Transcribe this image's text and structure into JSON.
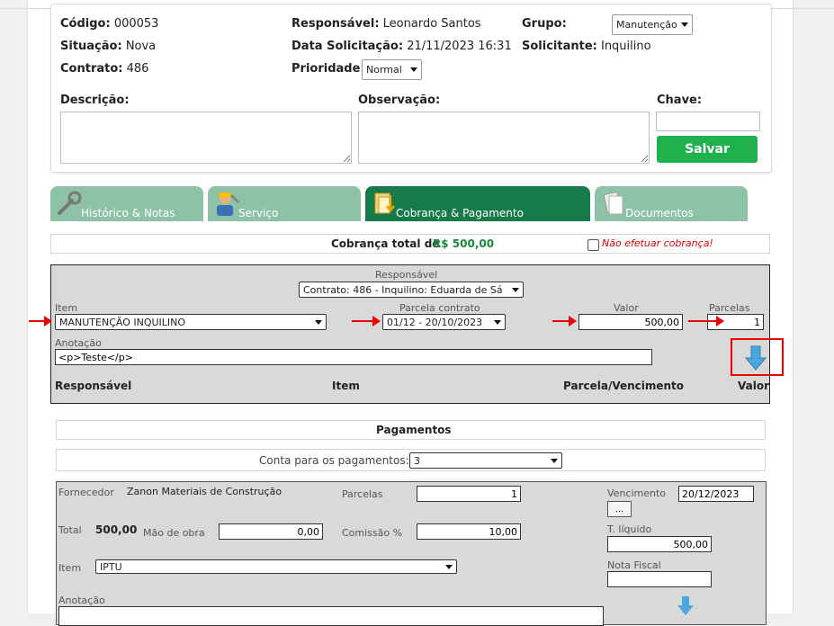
{
  "header": {
    "codigo_label": "Código:",
    "codigo": "000053",
    "situacao_label": "Situação:",
    "situacao": "Nova",
    "contrato_label": "Contrato:",
    "contrato": "486",
    "responsavel_label": "Responsável:",
    "responsavel": "Leonardo Santos",
    "data_label": "Data Solicitação:",
    "data": "21/11/2023 16:31",
    "prioridade_label": "Prioridade:",
    "prioridade": "Normal",
    "grupo_label": "Grupo:",
    "grupo": "Manutenção",
    "solicitante_label": "Solicitante:",
    "solicitante": "Inquilino",
    "descricao_label": "Descrição:",
    "observacao_label": "Observação:",
    "chave_label": "Chave:",
    "chave_value": "",
    "salvar_label": "Salvar"
  },
  "tabs": [
    {
      "label": "Histórico & Notas",
      "icon": "wrench-icon",
      "active": false
    },
    {
      "label": "Serviço",
      "icon": "worker-icon",
      "active": false
    },
    {
      "label": "Cobrança & Pagamento",
      "icon": "billing-icon",
      "active": true
    },
    {
      "label": "Documentos",
      "icon": "documents-icon",
      "active": false
    }
  ],
  "cobranca": {
    "total_label": "Cobrança total de",
    "total_value": "R$ 500,00",
    "nao_efetuar_label": "Não efetuar cobrança!"
  },
  "charge_form": {
    "responsavel_label": "Responsável",
    "responsavel_value": "Contrato: 486 - Inquilino: Eduarda de Sá",
    "item_label": "Item",
    "item_value": "MANUTENÇÃO INQUILINO",
    "parcela_label": "Parcela contrato",
    "parcela_value": "01/12 - 20/10/2023",
    "valor_label": "Valor",
    "valor_value": "500,00",
    "parcelas_label": "Parcelas",
    "parcelas_value": "1",
    "anotacao_label": "Anotação",
    "anotacao_value": "<p>Teste</p>",
    "col_responsavel": "Responsável",
    "col_item": "Item",
    "col_parcela": "Parcela/Vencimento",
    "col_valor": "Valor"
  },
  "pagamentos": {
    "title": "Pagamentos",
    "conta_label": "Conta para os pagamentos:",
    "conta_value": "3",
    "fornecedor_label": "Fornecedor",
    "fornecedor_value": "Zanon Materiais de Construção",
    "parcelas_label": "Parcelas",
    "parcelas_value": "1",
    "vencimento_label": "Vencimento",
    "vencimento_value": "20/12/2023",
    "more_label": "...",
    "total_label": "Total",
    "total_value": "500,00",
    "mao_obra_label": "Mão de obra",
    "mao_obra_value": "0,00",
    "comissao_label": "Comissão %",
    "comissao_value": "10,00",
    "liquido_label": "T. líquido",
    "liquido_value": "500,00",
    "item_label": "Item",
    "item_value": "IPTU",
    "nota_fiscal_label": "Nota Fiscal",
    "nota_fiscal_value": "",
    "anotacao_label": "Anotação"
  },
  "colors": {
    "accent": "#1fb14e",
    "tab_active": "#167a4b",
    "tab_inactive": "#8dc2a6",
    "highlight": "#e00000"
  }
}
